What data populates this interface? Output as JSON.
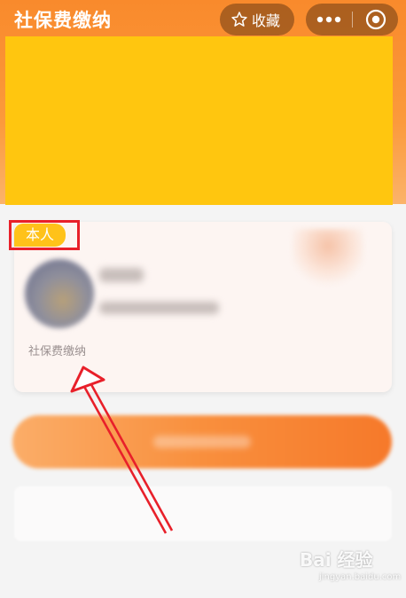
{
  "navbar": {
    "title": "社保费缴纳",
    "favorite_label": "收藏"
  },
  "card": {
    "tag_label": "本人",
    "service_label": "社保费缴纳"
  },
  "watermark": {
    "text": "Bai 经验",
    "sub": "jingyan.baidu.com"
  },
  "colors": {
    "header_orange": "#f98a2c",
    "banner_yellow": "#ffc60f",
    "tag_yellow": "#ffc21a",
    "annotation_red": "#e8202a"
  },
  "icons": [
    "star-icon",
    "more-dots-icon",
    "close-circle-icon",
    "arrow-annotation"
  ]
}
